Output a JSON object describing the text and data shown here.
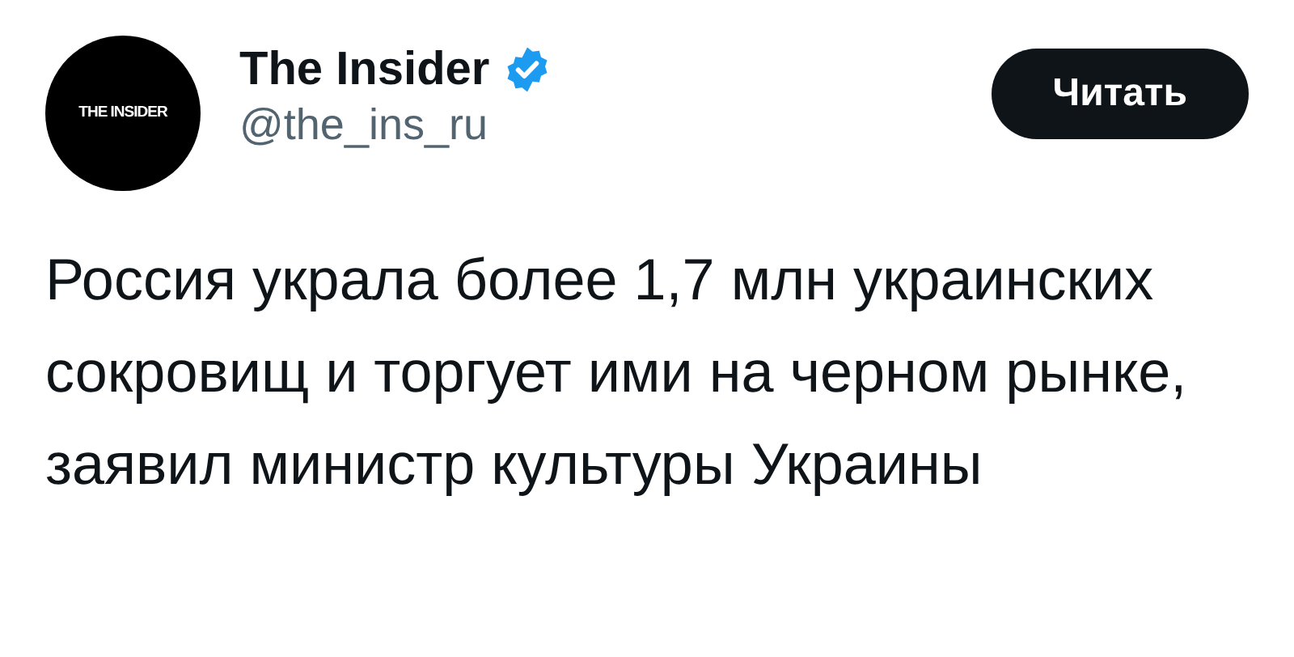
{
  "author": {
    "avatar_text": "THE INSIDER",
    "name": "The Insider",
    "verified": true,
    "handle": "@the_ins_ru"
  },
  "follow_button": {
    "label": "Читать"
  },
  "text": "Россия украла более 1,7 млн украинских сокровищ и торгует ими на черном рынке, заявил министр культуры Украины"
}
